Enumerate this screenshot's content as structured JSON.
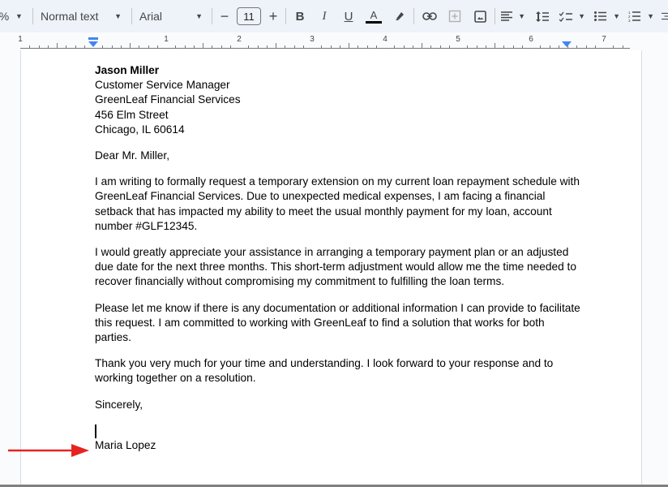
{
  "toolbar": {
    "zoom_fragment": "%",
    "style_select": "Normal text",
    "font_select": "Arial",
    "font_size": "11",
    "decrease_label": "−",
    "increase_label": "+",
    "bold_label": "B",
    "italic_label": "I",
    "underline_label": "U",
    "text_color_label": "A",
    "text_color": "#000000",
    "icons": [
      "highlighter-icon",
      "link-icon",
      "add-comment-icon",
      "insert-image-icon",
      "align-left-icon",
      "line-spacing-icon",
      "checklist-icon",
      "bulleted-list-icon",
      "numbered-list-icon",
      "indent-icon"
    ]
  },
  "ruler": {
    "labels": [
      "1",
      "1",
      "2",
      "3",
      "4",
      "5",
      "6",
      "7"
    ]
  },
  "document": {
    "recipient": {
      "name": "Jason Miller",
      "title": "Customer Service Manager",
      "company": "GreenLeaf Financial Services",
      "street": "456 Elm Street",
      "city": "Chicago, IL 60614"
    },
    "salutation": "Dear Mr. Miller,",
    "paragraphs": [
      "I am writing to formally request a temporary extension on my current loan repayment schedule with GreenLeaf Financial Services. Due to unexpected medical expenses, I am facing a financial setback that has impacted my ability to meet the usual monthly payment for my loan, account number #GLF12345.",
      "I would greatly appreciate your assistance in arranging a temporary payment plan or an adjusted due date for the next three months. This short-term adjustment would allow me the time needed to recover financially without compromising my commitment to fulfilling the loan terms.",
      "Please let me know if there is any documentation or additional information I can provide to facilitate this request. I am committed to working with GreenLeaf to find a solution that works for both parties.",
      "Thank you very much for your time and understanding. I look forward to your response and to working together on a resolution."
    ],
    "closing": "Sincerely,",
    "signature": "Maria Lopez"
  },
  "annotation": {
    "arrow_color": "#e52421"
  }
}
